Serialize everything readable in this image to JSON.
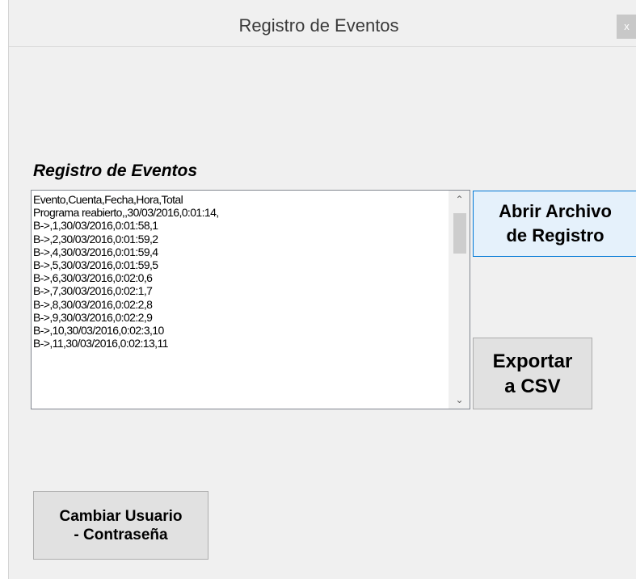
{
  "window": {
    "title": "Registro de Eventos",
    "close_label": "x"
  },
  "log": {
    "label": "Registro de Eventos",
    "lines": [
      "Evento,Cuenta,Fecha,Hora,Total",
      "Programa reabierto,,30/03/2016,0:01:14,",
      "B->,1,30/03/2016,0:01:58,1",
      "B->,2,30/03/2016,0:01:59,2",
      "B->,4,30/03/2016,0:01:59,4",
      "B->,5,30/03/2016,0:01:59,5",
      "B->,6,30/03/2016,0:02:0,6",
      "B->,7,30/03/2016,0:02:1,7",
      "B->,8,30/03/2016,0:02:2,8",
      "B->,9,30/03/2016,0:02:2,9",
      "B->,10,30/03/2016,0:02:3,10",
      "B->,11,30/03/2016,0:02:13,11"
    ],
    "scroll_up_icon": "chevron-up-icon",
    "scroll_down_icon": "chevron-down-icon"
  },
  "buttons": {
    "open_log": "Abrir Archivo\nde Registro",
    "export_csv": "Exportar\na CSV",
    "change_user": "Cambiar Usuario\n- Contraseña"
  },
  "colors": {
    "window_bg": "#f0f0f0",
    "focus_border": "#0078d7",
    "focus_bg": "#e5f1fb"
  }
}
